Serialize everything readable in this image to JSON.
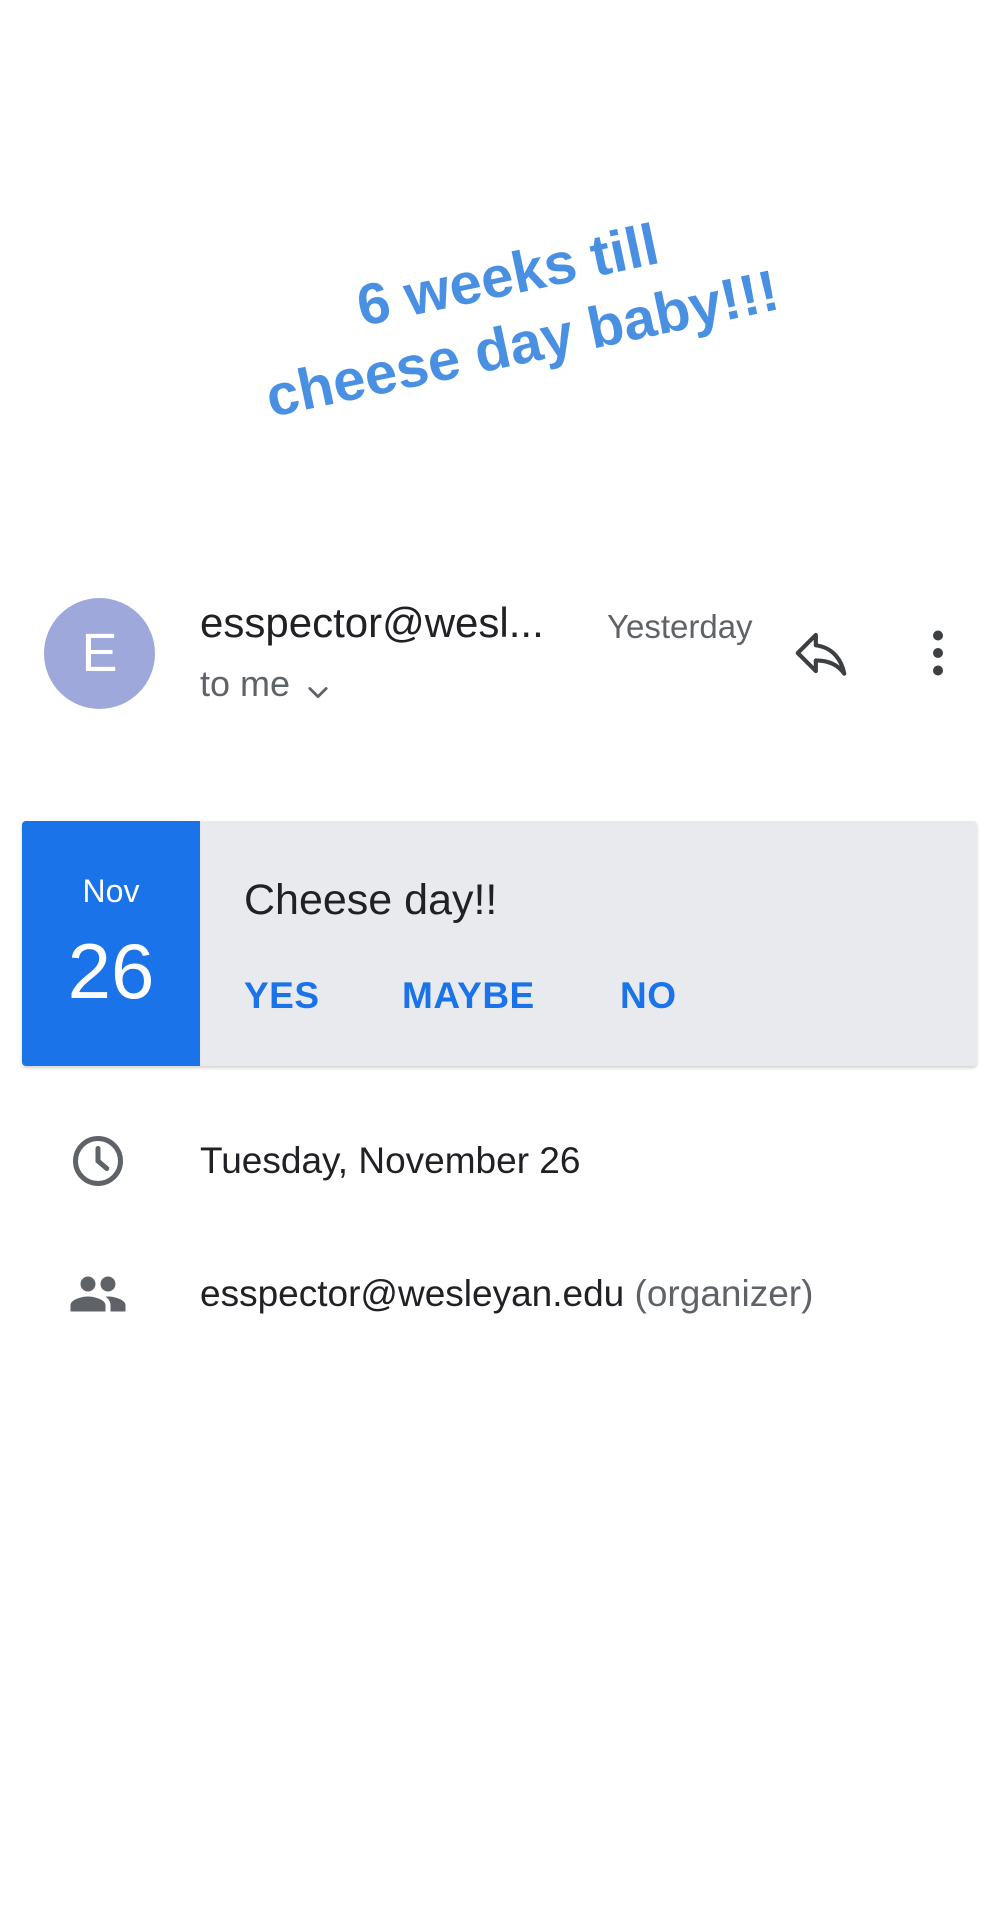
{
  "overlay": {
    "line1": "6 weeks till",
    "line2": "cheese day baby!!!"
  },
  "email": {
    "avatar_letter": "E",
    "sender": "esspector@wesl...",
    "timestamp": "Yesterday",
    "recipient": "to me",
    "icons": {
      "expand": "chevron-down-icon",
      "reply": "reply-icon",
      "more": "more-vert-icon"
    }
  },
  "invite": {
    "month": "Nov",
    "day": "26",
    "title": "Cheese day!!",
    "rsvp": {
      "yes": "YES",
      "maybe": "MAYBE",
      "no": "NO"
    }
  },
  "details": {
    "date": "Tuesday, November 26",
    "organizer_email": "esspector@wesleyan.edu",
    "organizer_role": "(organizer)",
    "icons": {
      "time": "clock-icon",
      "people": "people-icon"
    }
  },
  "colors": {
    "accent": "#1a73e8",
    "avatar": "#9fa8da",
    "overlay_text": "#4a90e2",
    "card_background": "#e8eaed"
  }
}
